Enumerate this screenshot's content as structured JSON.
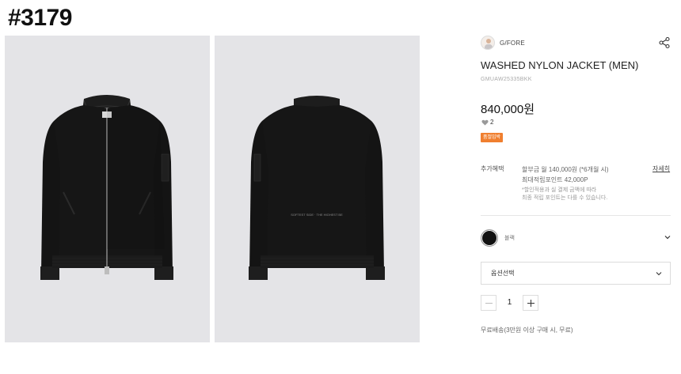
{
  "item_number": "#3179",
  "images": [
    {
      "name": "front",
      "print": ""
    },
    {
      "name": "back",
      "print": "SOFTEST SIDE · THE HIGHEST BE"
    }
  ],
  "brand": {
    "name": "G/FORE"
  },
  "product": {
    "title": "WASHED NYLON JACKET (MEN)",
    "code": "GMUAW25335BKK",
    "price": "840,000원",
    "likes": "2",
    "badge": "품절임박"
  },
  "benefits": {
    "label": "추가혜택",
    "installment": "할부금 월 140,000원 (*6개월 시)",
    "points": "최대적립포인트 42,000P",
    "detail_link": "자세히",
    "note_line1": "*할인적용과 실 결제 금액에 따라",
    "note_line2": "최종 적립 포인트는 다를 수 있습니다."
  },
  "color": {
    "label": "블랙",
    "swatch": "#111111"
  },
  "option": {
    "placeholder": "옵션선택"
  },
  "quantity": {
    "value": "1"
  },
  "shipping": "무료배송(3만원 이상 구매 시, 무료)",
  "colors": {
    "badge": "#f07f2f",
    "photo_bg": "#e4e4e7",
    "jacket": "#161616"
  },
  "icons": [
    "share-icon",
    "heart-icon",
    "chevron-down-icon",
    "minus-icon",
    "plus-icon"
  ]
}
